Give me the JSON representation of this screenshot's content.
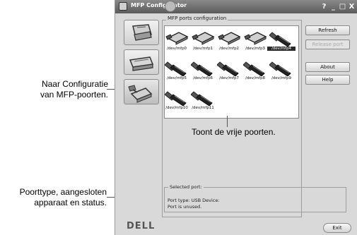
{
  "callouts": {
    "config_nav": "Naar Configuratie\nvan MFP-poorten.",
    "free_ports": "Toont de vrije poorten.",
    "port_status": "Poorttype, aangesloten\napparaat en status."
  },
  "window": {
    "title": "MFP Configurator",
    "controls": [
      "?",
      "_",
      "□",
      "X"
    ]
  },
  "ports_group": {
    "title": "MFP ports configuration",
    "ports": [
      {
        "label": "/dev/mfp0",
        "type": "parallel",
        "selected": false
      },
      {
        "label": "/dev/mfp1",
        "type": "parallel",
        "selected": false
      },
      {
        "label": "/dev/mfp2",
        "type": "parallel",
        "selected": false
      },
      {
        "label": "/dev/mfp3",
        "type": "parallel",
        "selected": false
      },
      {
        "label": "/dev/mfp4",
        "type": "usb",
        "selected": true
      },
      {
        "label": "/dev/mfp5",
        "type": "usb",
        "selected": false
      },
      {
        "label": "/dev/mfp6",
        "type": "usb",
        "selected": false
      },
      {
        "label": "/dev/mfp7",
        "type": "usb",
        "selected": false
      },
      {
        "label": "/dev/mfp8",
        "type": "usb",
        "selected": false
      },
      {
        "label": "/dev/mfp9",
        "type": "usb",
        "selected": false
      },
      {
        "label": "/dev/mfp10",
        "type": "usb",
        "selected": false
      },
      {
        "label": "/dev/mfp11",
        "type": "usb",
        "selected": false
      }
    ]
  },
  "buttons": {
    "refresh": "Refresh",
    "release_port": "Release port",
    "about": "About",
    "help": "Help",
    "exit": "Exit"
  },
  "selected_port": {
    "title": "Selected port:",
    "line1": "Port type: USB   Device:",
    "line2": "Port is unused."
  },
  "brand": "DELL",
  "sidebar": {
    "items": [
      "printer-icon",
      "scanner-icon",
      "ports-config-icon"
    ]
  }
}
